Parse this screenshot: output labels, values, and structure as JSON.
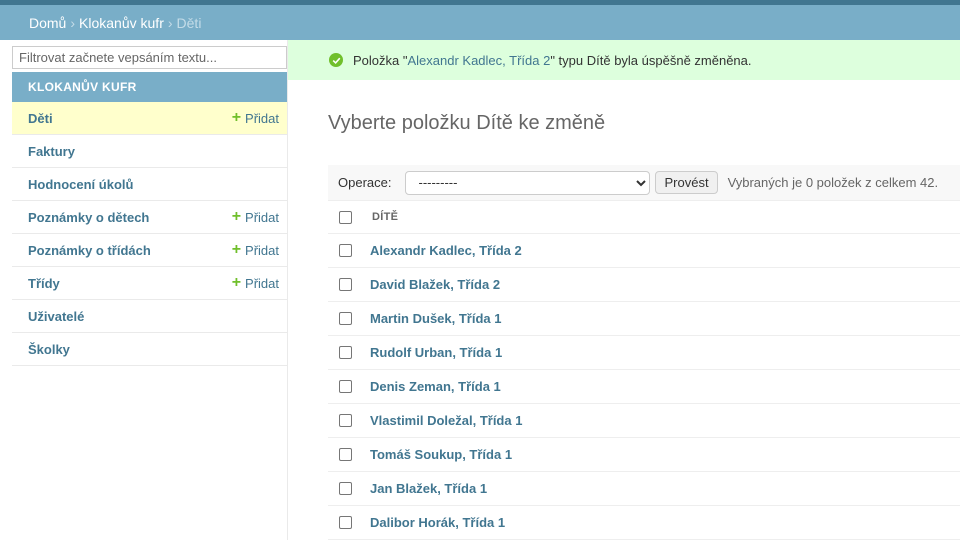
{
  "breadcrumbs": {
    "home": "Domů",
    "app": "Klokanův kufr",
    "current": "Děti",
    "separator": "›"
  },
  "sidebar": {
    "filter_placeholder": "Filtrovat začnete vepsáním textu...",
    "app_caption": "KLOKANŮV KUFR",
    "add_label": "Přidat",
    "items": [
      {
        "label": "Děti",
        "has_add": true,
        "active": true
      },
      {
        "label": "Faktury",
        "has_add": false
      },
      {
        "label": "Hodnocení úkolů",
        "has_add": false
      },
      {
        "label": "Poznámky o dětech",
        "has_add": true
      },
      {
        "label": "Poznámky o třídách",
        "has_add": true
      },
      {
        "label": "Třídy",
        "has_add": true
      },
      {
        "label": "Uživatelé",
        "has_add": false
      },
      {
        "label": "Školky",
        "has_add": false
      }
    ]
  },
  "message": {
    "prefix": "Položka \"",
    "link": "Alexandr Kadlec, Třída 2",
    "suffix": "\" typu Dítě byla úspěšně změněna."
  },
  "main": {
    "title": "Vyberte položku Dítě ke změně",
    "actions": {
      "label": "Operace:",
      "selected_option": "---------",
      "go_label": "Provést",
      "counter": "Vybraných je 0 položek z celkem 42."
    },
    "table": {
      "column": "DÍTĚ",
      "rows": [
        "Alexandr Kadlec, Třída 2",
        "David Blažek, Třída 2",
        "Martin Dušek, Třída 1",
        "Rudolf Urban, Třída 1",
        "Denis Zeman, Třída 1",
        "Vlastimil Doležal, Třída 1",
        "Tomáš Soukup, Třída 1",
        "Jan Blažek, Třída 1",
        "Dalibor Horák, Třída 1"
      ]
    }
  },
  "colors": {
    "header_dark": "#417690",
    "header": "#79aec8",
    "success_bg": "#ddffdd",
    "active_row": "#ffffcc",
    "add_icon": "#70bf2b"
  }
}
